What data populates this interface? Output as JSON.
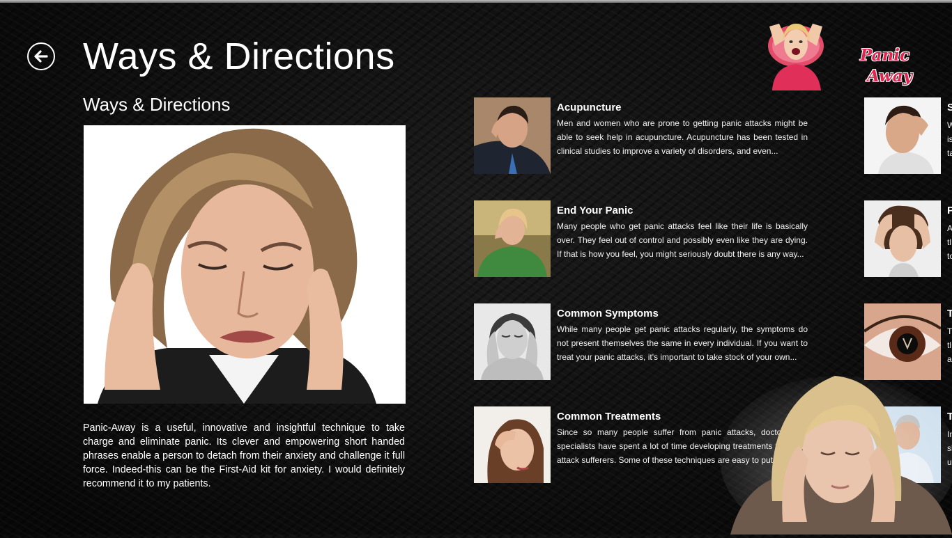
{
  "header": {
    "title": "Ways & Directions",
    "back_label": "Back"
  },
  "logo": {
    "line1": "Panic",
    "line2": "Away"
  },
  "detail": {
    "section_title": "Ways & Directions",
    "description": "Panic-Away is a useful, innovative and insightful technique to take charge and eliminate panic. Its clever and empowering short handed phrases enable a person to detach from their anxiety and challenge it full force. Indeed-this can be the First-Aid kit for anxiety. I would definitely recommend it to my patients."
  },
  "items": [
    {
      "title": "Acupuncture",
      "text": "Men and women who are prone to getting panic attacks might be able to seek help in acupuncture. Acupuncture has been tested in clinical studies to improve a variety of disorders, and even..."
    },
    {
      "title": "End Your Panic",
      "text": "Many people who get panic attacks feel like their life is basically over. They feel out of control and possibly even like they are dying. If that is how you feel, you might seriously doubt there is any way..."
    },
    {
      "title": "Common Symptoms",
      "text": "While many people get panic attacks regularly, the symptoms do not present themselves the same in every individual. If you want to treat your panic attacks, it's important to take stock of your own..."
    },
    {
      "title": "Common Treatments",
      "text": "Since so many people suffer from panic attacks, doctors and specialists have spent a lot of time developing treatments for panic attack sufferers. Some of these techniques are easy to put into..."
    }
  ],
  "items_col2": [
    {
      "initial": "S",
      "lines": [
        "W",
        "is",
        "ta"
      ]
    },
    {
      "initial": "P",
      "lines": [
        "A",
        "tl",
        "to"
      ]
    },
    {
      "initial": "T",
      "lines": [
        "T",
        "tl",
        "a"
      ]
    },
    {
      "initial": "T",
      "lines": [
        "In",
        "sl",
        "u"
      ]
    }
  ]
}
